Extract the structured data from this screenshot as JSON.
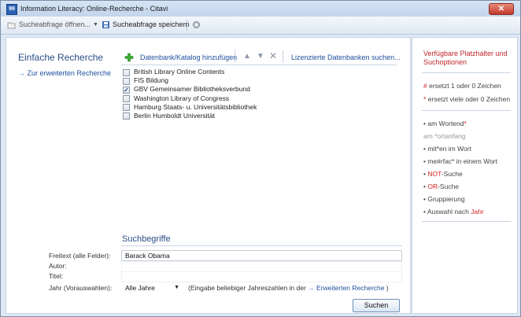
{
  "window": {
    "title": "Information Literacy: Online-Recherche - Citavi",
    "close": "✕"
  },
  "toolbar": {
    "open_label": "Sucheabfrage öffnen...",
    "save_label": "Sucheabfrage speichern"
  },
  "left": {
    "heading": "Einfache Recherche",
    "advanced_link": "Zur erweiterten Recherche"
  },
  "db_toolbar": {
    "add_label": "Datenbank/Katalog hinzufügen",
    "licensed_link": "Lizenzierte Datenbanken suchen..."
  },
  "databases": [
    {
      "label": "British Library Online Contents",
      "checked": false
    },
    {
      "label": "FIS Bildung",
      "checked": false
    },
    {
      "label": "GBV Gemeinsamer Bibliotheksverbund",
      "checked": true
    },
    {
      "label": "Washington Library of Congress",
      "checked": false
    },
    {
      "label": "Hamburg Staats- u. Universitätsbibliothek",
      "checked": false
    },
    {
      "label": "Berlin Humboldt Universität",
      "checked": false
    }
  ],
  "search": {
    "heading": "Suchbegriffe",
    "freetext_label": "Freitext (alle Felder):",
    "freetext_value": "Barack Obama",
    "author_label": "Autor:",
    "title_label": "Titel:",
    "year_label": "Jahr (Vorauswahlen):",
    "year_value": "Alle Jahre",
    "year_hint_prefix": "(Eingabe beliebiger Jahreszahlen in der",
    "year_hint_link": "Erweiterten Recherche",
    "year_hint_suffix": ")",
    "submit_label": "Suchen"
  },
  "help": {
    "title": "Verfügbare Platzhalter und Suchoptionen",
    "hash_symbol": "#",
    "hash_text": "ersetzt 1 oder 0 Zeichen",
    "star_symbol": "*",
    "star_text": "ersetzt viele oder 0 Zeichen",
    "opt1_text": "am Wortend",
    "opt1_red": "*",
    "opt2_text": "am *ortanfang",
    "opt3_text": "mit*en im Wort",
    "opt4_text": "me#rfac* in einem Wort",
    "opt5_red": "NOT",
    "opt5_text": "-Suche",
    "opt6_red": "OR",
    "opt6_text": "-Suche",
    "opt7_text": "Gruppierung",
    "opt8_text": "Auswahl nach ",
    "opt8_red": "Jahr"
  }
}
